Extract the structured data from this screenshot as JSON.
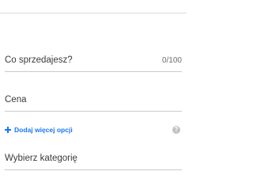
{
  "form": {
    "title_field": {
      "placeholder": "Co sprzedajesz?",
      "counter": "0/100"
    },
    "price_field": {
      "placeholder": "Cena"
    },
    "more_options": {
      "label": "Dodaj więcej opcji",
      "icon": "plus-icon",
      "help_icon": "help-icon",
      "help_glyph": "?"
    },
    "category_field": {
      "placeholder": "Wybierz kategorię"
    },
    "accent_color": "#1877f2"
  }
}
